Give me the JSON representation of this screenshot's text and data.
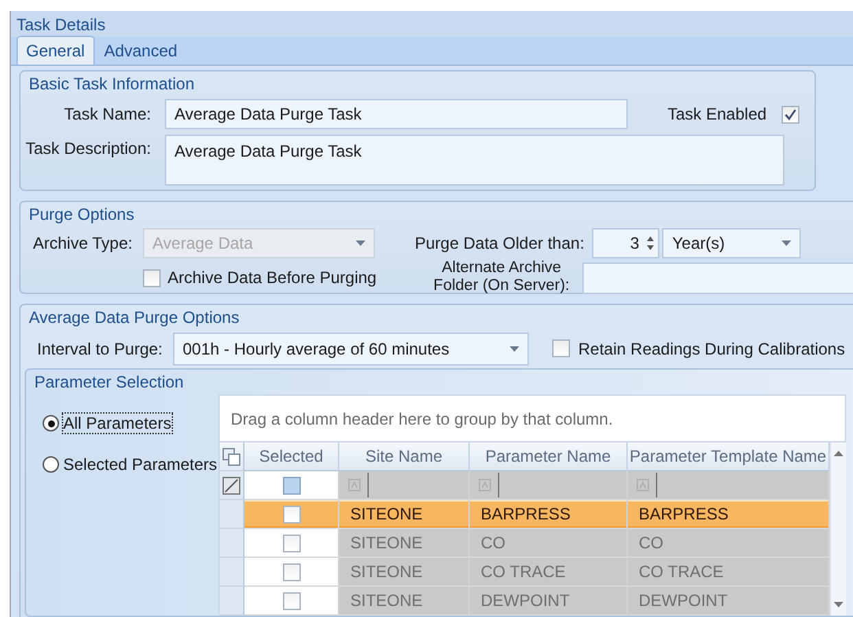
{
  "panel_title": "Task Details",
  "tabs": [
    {
      "label": "General",
      "selected": true
    },
    {
      "label": "Advanced",
      "selected": false
    }
  ],
  "basic_info": {
    "title": "Basic Task Information",
    "task_name": {
      "label": "Task Name:",
      "value": "Average Data Purge Task"
    },
    "task_enabled": {
      "label": "Task Enabled",
      "checked": true
    },
    "task_description": {
      "label": "Task Description:",
      "value": "Average Data Purge Task"
    }
  },
  "purge_options": {
    "title": "Purge Options",
    "archive_type": {
      "label": "Archive Type:",
      "value": "Average Data",
      "disabled": true
    },
    "purge_older_than": {
      "label": "Purge Data Older than:",
      "value": "3",
      "unit": "Year(s)"
    },
    "archive_before_purging": {
      "label": "Archive Data Before Purging",
      "checked": false
    },
    "alternate_folder": {
      "label": "Alternate Archive Folder (On Server):"
    }
  },
  "average_options": {
    "title": "Average Data Purge Options",
    "interval": {
      "label": "Interval to Purge:",
      "value": "001h - Hourly average of 60 minutes"
    },
    "retain_readings": {
      "label": "Retain Readings During Calibrations",
      "checked": false
    }
  },
  "parameter_selection": {
    "title": "Parameter Selection",
    "options": [
      {
        "label": "All Parameters",
        "selected": true
      },
      {
        "label": "Selected Parameters",
        "selected": false
      }
    ],
    "grid": {
      "disabled": true,
      "group_hint": "Drag a column header here to group by that column.",
      "columns": [
        "Selected",
        "Site Name",
        "Parameter Name",
        "Parameter Template Name"
      ],
      "filter_checkbox": {
        "indeterminate": true
      },
      "rows": [
        {
          "checked": false,
          "selected": true,
          "site_name": "SITEONE",
          "parameter_name": "BARPRESS",
          "parameter_template_name": "BARPRESS"
        },
        {
          "checked": false,
          "selected": false,
          "site_name": "SITEONE",
          "parameter_name": "CO",
          "parameter_template_name": "CO"
        },
        {
          "checked": false,
          "selected": false,
          "site_name": "SITEONE",
          "parameter_name": "CO TRACE",
          "parameter_template_name": "CO TRACE"
        },
        {
          "checked": false,
          "selected": false,
          "site_name": "SITEONE",
          "parameter_name": "DEWPOINT",
          "parameter_template_name": "DEWPOINT"
        }
      ]
    }
  }
}
